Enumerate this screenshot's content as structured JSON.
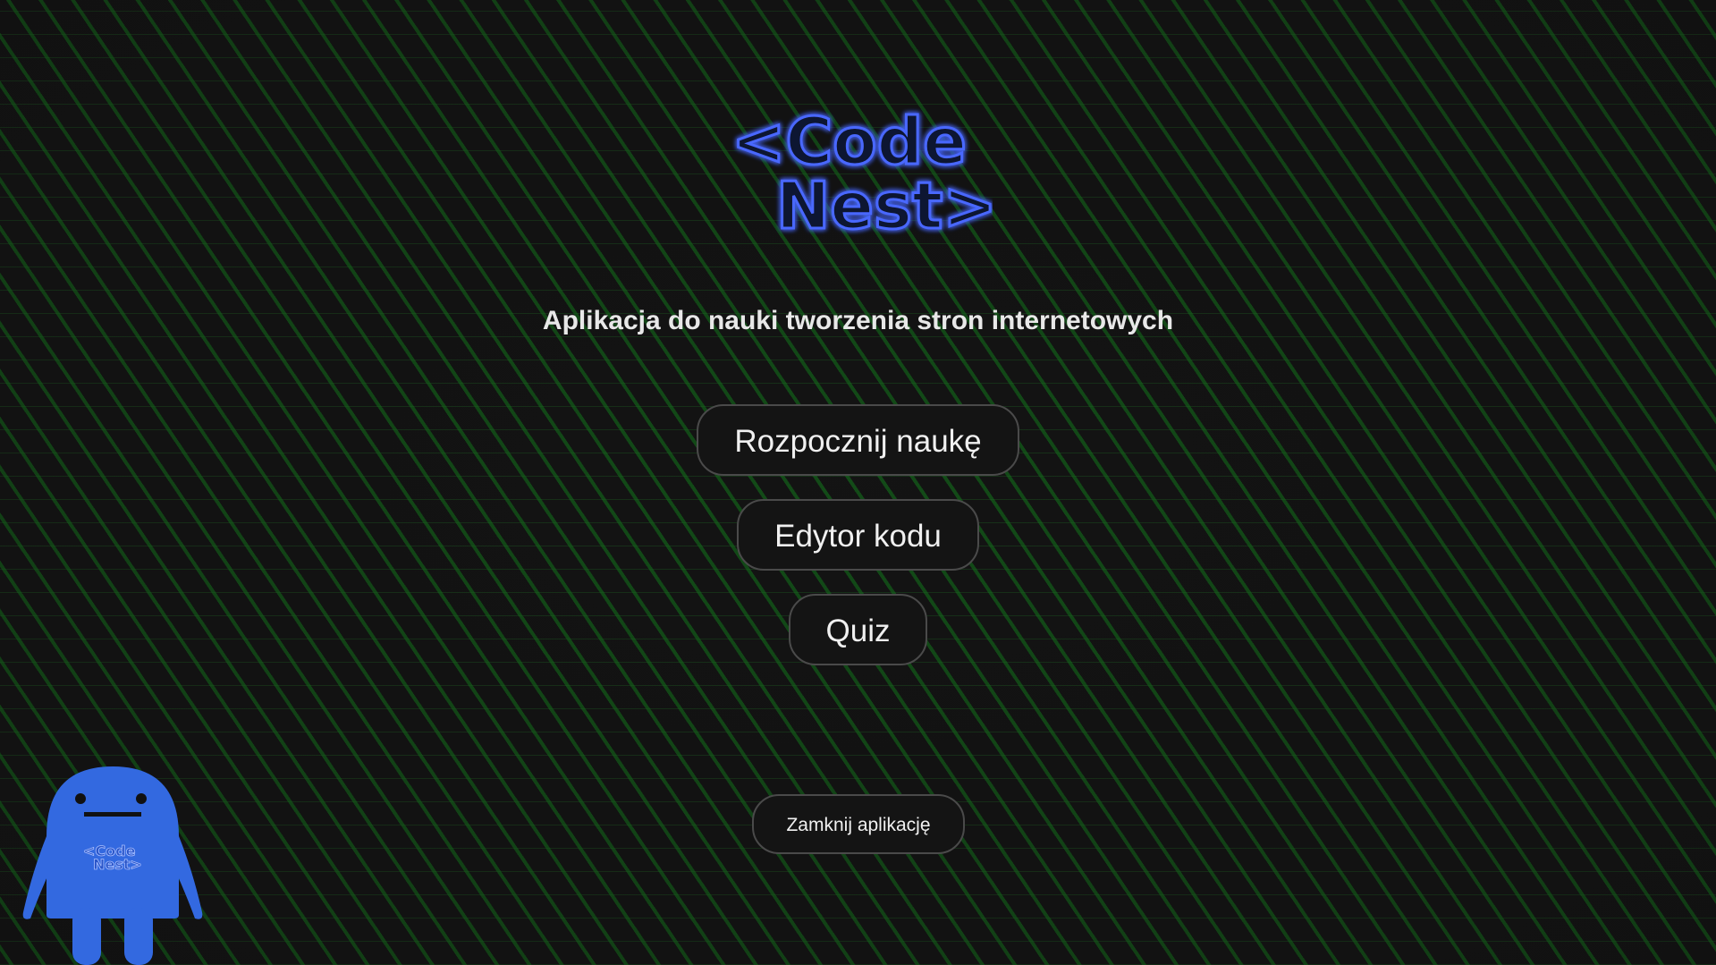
{
  "app": {
    "logo_text": [
      "<Code",
      "Nest>"
    ],
    "subtitle": "Aplikacja do nauki tworzenia stron internetowych",
    "logo_color": "#3b5bff",
    "background_color": "#151515",
    "pattern_color": "#1a8c1e"
  },
  "menu": {
    "start_label": "Rozpocznij naukę",
    "editor_label": "Edytor kodu",
    "quiz_label": "Quiz"
  },
  "footer": {
    "close_label": "Zamknij aplikację"
  },
  "mascot": {
    "badge_text": [
      "<Code",
      "Nest>"
    ],
    "color": "#3369e0"
  }
}
